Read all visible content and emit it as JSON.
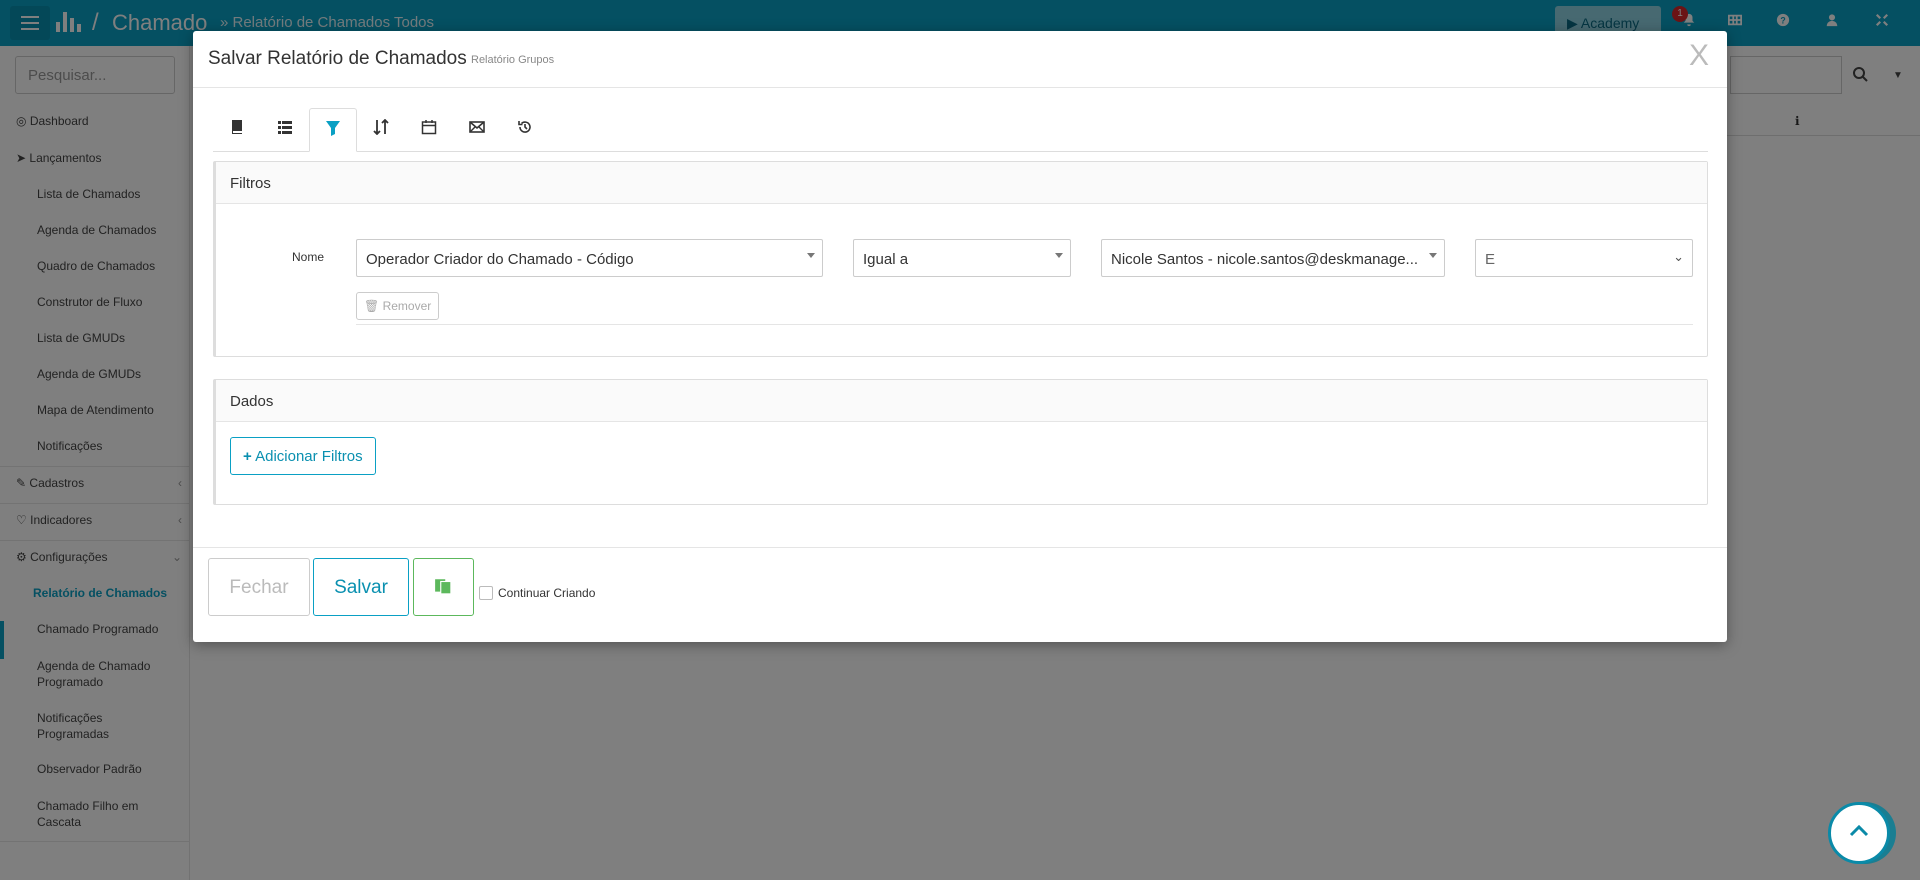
{
  "topbar": {
    "app_title": "Chamado",
    "breadcrumb": "» Relatório de Chamados Todos",
    "separator": "/",
    "academy_label": "Academy",
    "notification_count": "1",
    "icons": [
      "bell-icon",
      "grid-icon",
      "question-icon",
      "user-icon",
      "fullscreen-icon"
    ]
  },
  "sidebar": {
    "search_placeholder": "Pesquisar...",
    "items": [
      {
        "label": "Dashboard",
        "icon": "dashboard-icon"
      },
      {
        "label": "Lançamentos",
        "icon": "rocket-icon"
      },
      {
        "label": "Lista de Chamados"
      },
      {
        "label": "Agenda de Chamados"
      },
      {
        "label": "Quadro de Chamados"
      },
      {
        "label": "Construtor de Fluxo"
      },
      {
        "label": "Lista de GMUDs"
      },
      {
        "label": "Agenda de GMUDs"
      },
      {
        "label": "Mapa de Atendimento"
      },
      {
        "label": "Notificações"
      },
      {
        "label": "Cadastros",
        "icon": "edit-icon"
      },
      {
        "label": "Indicadores",
        "icon": "heart-icon"
      },
      {
        "label": "Configurações",
        "icon": "gear-icon"
      },
      {
        "label": "Relatório de Chamados",
        "active": true
      },
      {
        "label": "Chamado Programado"
      },
      {
        "label": "Agenda de Chamado Programado"
      },
      {
        "label": "Notificações Programadas"
      },
      {
        "label": "Observador Padrão"
      },
      {
        "label": "Chamado Filho em Cascata"
      }
    ]
  },
  "modal": {
    "title": "Salvar Relatório de Chamados",
    "subtitle": "Relatório Grupos",
    "close_label": "X",
    "tabs": [
      {
        "icon": "book-icon"
      },
      {
        "icon": "list-icon"
      },
      {
        "icon": "filter-icon",
        "active": true
      },
      {
        "icon": "sort-icon"
      },
      {
        "icon": "calendar-icon"
      },
      {
        "icon": "envelope-icon"
      },
      {
        "icon": "history-icon"
      }
    ],
    "filtros": {
      "heading": "Filtros",
      "field_label": "Nome",
      "field_value": "Operador Criador do Chamado - Código",
      "operator_value": "Igual a",
      "value_value": "Nicole Santos - nicole.santos@deskmanage...",
      "logic_value": "E",
      "remove_label": "Remover"
    },
    "dados": {
      "heading": "Dados",
      "add_filter_label": "Adicionar Filtros"
    },
    "footer": {
      "fechar_label": "Fechar",
      "salvar_label": "Salvar",
      "continue_label": "Continuar Criando"
    }
  },
  "colors": {
    "accent": "#0aa0c4",
    "success": "#5cb85c",
    "danger": "#d6262b"
  }
}
